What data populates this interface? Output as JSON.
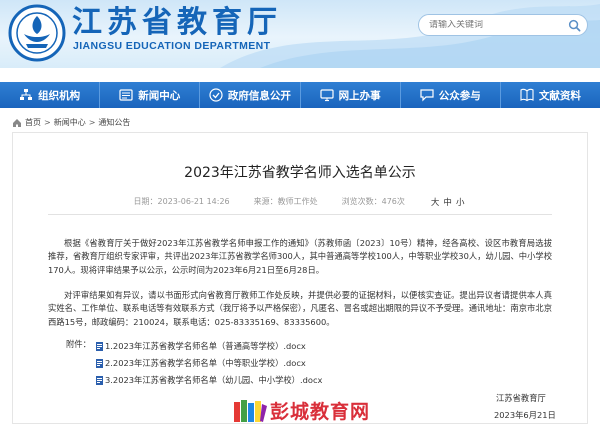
{
  "header": {
    "site_name": "江苏省教育厅",
    "site_sub": "JIANGSU EDUCATION DEPARTMENT",
    "search_placeholder": "请输入关键词"
  },
  "nav": {
    "items": [
      {
        "label": "组织机构",
        "icon": "org-icon"
      },
      {
        "label": "新闻中心",
        "icon": "news-icon"
      },
      {
        "label": "政府信息公开",
        "icon": "info-icon"
      },
      {
        "label": "网上办事",
        "icon": "monitor-icon"
      },
      {
        "label": "公众参与",
        "icon": "chat-icon"
      },
      {
        "label": "文献资料",
        "icon": "book-icon"
      }
    ]
  },
  "breadcrumb": {
    "items": [
      "首页",
      "新闻中心",
      "通知公告"
    ],
    "sep": ">"
  },
  "article": {
    "title": "2023年江苏省教学名师入选名单公示",
    "meta": {
      "date": "日期：2023-06-21 14:26",
      "source": "来源：教师工作处",
      "views": "浏览次数：476次"
    },
    "font_size": {
      "big": "大",
      "mid": "中",
      "small": "小"
    },
    "paragraphs": [
      "根据《省教育厅关于做好2023年江苏省教学名师申报工作的通知》（苏教师函〔2023〕10号）精神，经各高校、设区市教育局选拔推荐，省教育厅组织专家评审，共评出2023年江苏省教学名师300人，其中普通高等学校100人，中等职业学校30人，幼儿园、中小学校170人。现将评审结果予以公示，公示时间为2023年6月21日至6月28日。",
      "对评审结果如有异议，请以书面形式向省教育厅教师工作处反映，并提供必要的证据材料，以便核实查证。提出异议者请提供本人真实姓名、工作单位、联系电话等有效联系方式（我厅将予以严格保密），凡匿名、冒名或超出期限的异议不予受理。通讯地址：南京市北京西路15号，邮政编码：210024，联系电话：025-83335169、83335600。"
    ],
    "attach_label": "附件：",
    "attachments": [
      "1.2023年江苏省教学名师名单（普通高等学校）.docx",
      "2.2023年江苏省教学名师名单（中等职业学校）.docx",
      "3.2023年江苏省教学名师名单（幼儿园、中小学校）.docx"
    ],
    "signature_org": "江苏省教育厅",
    "signature_date": "2023年6月21日"
  },
  "watermark": {
    "text": "彭城教育网"
  },
  "colors": {
    "brand": "#1565b8",
    "nav": "#1a64bd",
    "watermark": "#d92f3a"
  }
}
